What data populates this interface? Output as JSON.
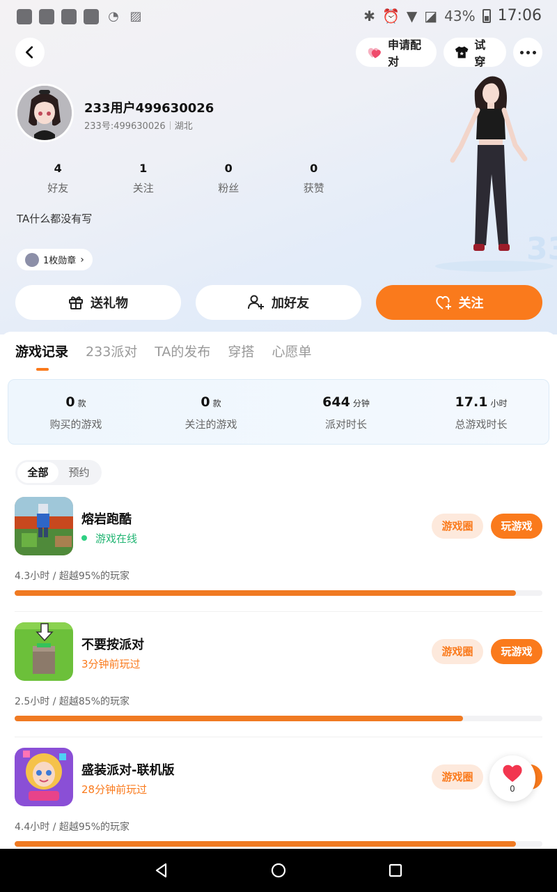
{
  "status_bar": {
    "battery": "43%",
    "time": "17:06"
  },
  "top_actions": {
    "match_label": "申请配对",
    "try_on_label": "试穿"
  },
  "profile": {
    "username": "233用户499630026",
    "id_line": "233号:499630026",
    "region": "湖北",
    "bio": "TA什么都没有写",
    "medals_label": "1枚勋章",
    "stats": [
      {
        "value": "4",
        "label": "好友"
      },
      {
        "value": "1",
        "label": "关注"
      },
      {
        "value": "0",
        "label": "粉丝"
      },
      {
        "value": "0",
        "label": "获赞"
      }
    ]
  },
  "actions": {
    "gift": "送礼物",
    "add_friend": "加好友",
    "follow": "关注"
  },
  "tabs": [
    "游戏记录",
    "233派对",
    "TA的发布",
    "穿搭",
    "心愿单"
  ],
  "active_tab": "游戏记录",
  "summary": [
    {
      "value": "0",
      "unit": "款",
      "label": "购买的游戏"
    },
    {
      "value": "0",
      "unit": "款",
      "label": "关注的游戏"
    },
    {
      "value": "644",
      "unit": "分钟",
      "label": "派对时长"
    },
    {
      "value": "17.1",
      "unit": "小时",
      "label": "总游戏时长"
    }
  ],
  "filter": {
    "all": "全部",
    "reserve": "预约"
  },
  "games": [
    {
      "title": "熔岩跑酷",
      "status": "游戏在线",
      "status_type": "online",
      "circle_label": "游戏圈",
      "play_label": "玩游戏",
      "stat_line": "4.3小时 / 超越95%的玩家",
      "progress": 0.95
    },
    {
      "title": "不要按派对",
      "status": "3分钟前玩过",
      "status_type": "recent",
      "circle_label": "游戏圈",
      "play_label": "玩游戏",
      "stat_line": "2.5小时 / 超越85%的玩家",
      "progress": 0.85
    },
    {
      "title": "盛装派对-联机版",
      "status": "28分钟前玩过",
      "status_type": "recent",
      "circle_label": "游戏圈",
      "play_label": "玩游戏",
      "stat_line": "4.4小时 / 超越95%的玩家",
      "progress": 0.95
    }
  ],
  "like_count": "0",
  "colors": {
    "accent": "#fa7a1c",
    "online": "#22b573"
  }
}
